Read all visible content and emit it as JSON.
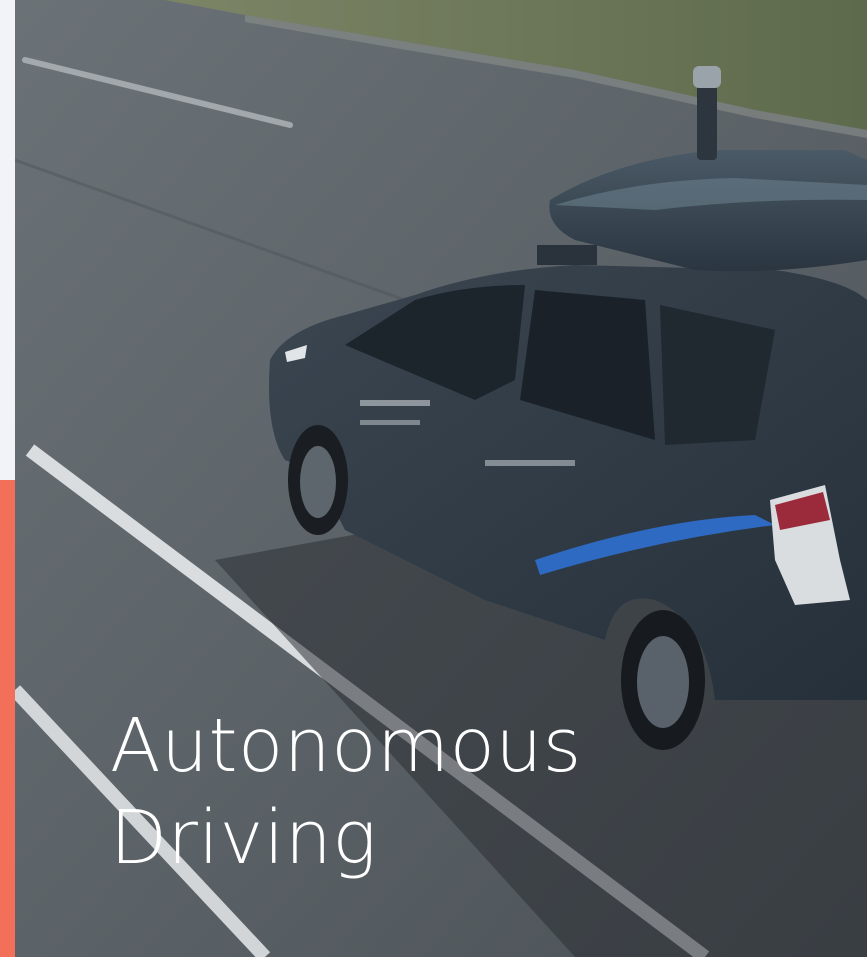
{
  "hero": {
    "title_line_1": "Autonomous",
    "title_line_2": "Driving",
    "image_subject": "autonomous-test-vehicle-on-road"
  },
  "colors": {
    "accent": "#f2705a",
    "strip_background": "#f1f3f8",
    "title_text": "#ffffff",
    "road": "#5d6469",
    "vehicle_body": "#2f3a44",
    "vehicle_stripe": "#2f6fd0"
  }
}
